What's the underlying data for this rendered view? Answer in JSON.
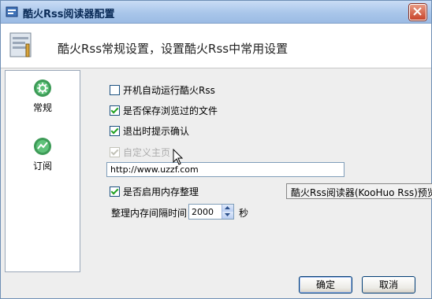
{
  "window": {
    "title": "酷火Rss阅读器配置",
    "close_label": "✕"
  },
  "header": {
    "title": "酷火Rss常规设置，设置酷火Rss中常用设置"
  },
  "sidebar": {
    "items": [
      {
        "label": "常规",
        "icon": "gear-icon"
      },
      {
        "label": "订阅",
        "icon": "feed-icon"
      }
    ]
  },
  "options": {
    "autostart": {
      "label": "开机自动运行酷火Rss",
      "checked": false
    },
    "save_history": {
      "label": "是否保存浏览过的文件",
      "checked": true
    },
    "exit_confirm": {
      "label": "退出时提示确认",
      "checked": true
    },
    "custom_home": {
      "label": "自定义主页",
      "checked": true,
      "disabled": true
    },
    "memory_cleanup": {
      "label": "是否启用内存整理",
      "checked": true
    }
  },
  "homepage_url": "http://www.uzzf.com",
  "memory_interval": {
    "label": "整理内存间隔时间",
    "value": "2000",
    "unit": "秒"
  },
  "tooltip": "酷火Rss阅读器(KooHuo Rss)预览",
  "buttons": {
    "ok": "确定",
    "cancel": "取消"
  },
  "colors": {
    "titlebar": "#a9c6ea",
    "check": "#21a121",
    "close": "#c8452c"
  }
}
